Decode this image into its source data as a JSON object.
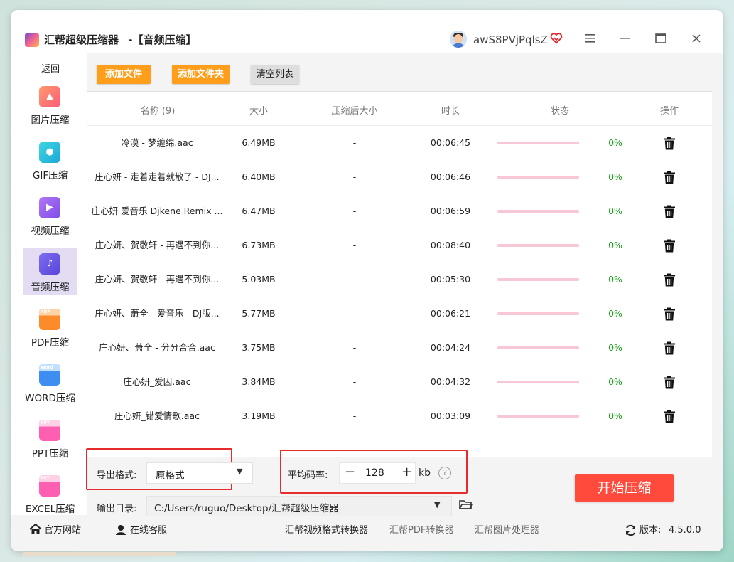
{
  "app": {
    "title": "汇帮超级压缩器",
    "subtitle": "-【音频压缩】",
    "username": "awS8PVjPqlsZ"
  },
  "window_controls": {
    "menu": "≡",
    "minimize": "—",
    "maximize": "☐",
    "close": "✕"
  },
  "sidebar": {
    "back": "返回",
    "items": [
      {
        "label": "图片压缩",
        "icon": "image-icon"
      },
      {
        "label": "GIF压缩",
        "icon": "gif-icon"
      },
      {
        "label": "视频压缩",
        "icon": "video-icon"
      },
      {
        "label": "音频压缩",
        "icon": "audio-icon",
        "active": true
      },
      {
        "label": "PDF压缩",
        "icon": "pdf-icon",
        "tag": "PDF"
      },
      {
        "label": "WORD压缩",
        "icon": "word-icon",
        "tag": "Word"
      },
      {
        "label": "PPT压缩",
        "icon": "ppt-icon",
        "tag": "PPT"
      },
      {
        "label": "EXCEL压缩",
        "icon": "excel-icon",
        "tag": "PPT"
      }
    ]
  },
  "toolbar": {
    "add_file": "添加文件",
    "add_folder": "添加文件夹",
    "clear_list": "清空列表"
  },
  "table": {
    "headers": {
      "name": "名称 (9)",
      "size": "大小",
      "compressed_size": "压缩后大小",
      "duration": "时长",
      "status": "状态",
      "action": "操作"
    },
    "rows": [
      {
        "name": "冷漠 - 梦缠绵.aac",
        "size": "6.49MB",
        "compressed": "-",
        "duration": "00:06:45",
        "progress": 0,
        "percent": "0%"
      },
      {
        "name": "庄心妍 - 走着走着就散了 - DJ...",
        "size": "6.40MB",
        "compressed": "-",
        "duration": "00:06:46",
        "progress": 0,
        "percent": "0%"
      },
      {
        "name": "庄心妍 爱音乐 Djkene Remix ...",
        "size": "6.47MB",
        "compressed": "-",
        "duration": "00:06:59",
        "progress": 0,
        "percent": "0%"
      },
      {
        "name": "庄心妍、贺敬轩 - 再遇不到你...",
        "size": "6.73MB",
        "compressed": "-",
        "duration": "00:08:40",
        "progress": 0,
        "percent": "0%"
      },
      {
        "name": "庄心妍、贺敬轩 - 再遇不到你...",
        "size": "5.03MB",
        "compressed": "-",
        "duration": "00:05:30",
        "progress": 0,
        "percent": "0%"
      },
      {
        "name": "庄心妍、萧全 - 爱音乐 - DJ版...",
        "size": "5.77MB",
        "compressed": "-",
        "duration": "00:06:21",
        "progress": 0,
        "percent": "0%"
      },
      {
        "name": "庄心妍、萧全 - 分分合合.aac",
        "size": "3.75MB",
        "compressed": "-",
        "duration": "00:04:24",
        "progress": 0,
        "percent": "0%"
      },
      {
        "name": "庄心妍_爱囚.aac",
        "size": "3.84MB",
        "compressed": "-",
        "duration": "00:04:32",
        "progress": 0,
        "percent": "0%"
      },
      {
        "name": "庄心妍_错爱情歌.aac",
        "size": "3.19MB",
        "compressed": "-",
        "duration": "00:03:09",
        "progress": 0,
        "percent": "0%"
      }
    ]
  },
  "settings": {
    "format_label": "导出格式:",
    "format_value": "原格式",
    "bitrate_label": "平均码率:",
    "bitrate_minus": "−",
    "bitrate_value": "128",
    "bitrate_plus": "+",
    "bitrate_unit": "kb",
    "help": "?",
    "output_label": "输出目录:",
    "output_path": "C:/Users/ruguo/Desktop/汇帮超级压缩器"
  },
  "start_button": "开始压缩",
  "footer": {
    "website": "官方网站",
    "support": "在线客服",
    "link1": "汇帮视频格式转换器",
    "link2": "汇帮PDF转换器",
    "link3": "汇帮图片处理器",
    "version_label": "版本:",
    "version": "4.5.0.0"
  },
  "colors": {
    "accent_orange": "#ff9e1b",
    "start_red": "#ff4a3c",
    "highlight_frame": "#e52b2b",
    "progress_track": "#f8c7d6",
    "percent_green": "#1aa31a",
    "active_nav": "#e3dcf3"
  }
}
